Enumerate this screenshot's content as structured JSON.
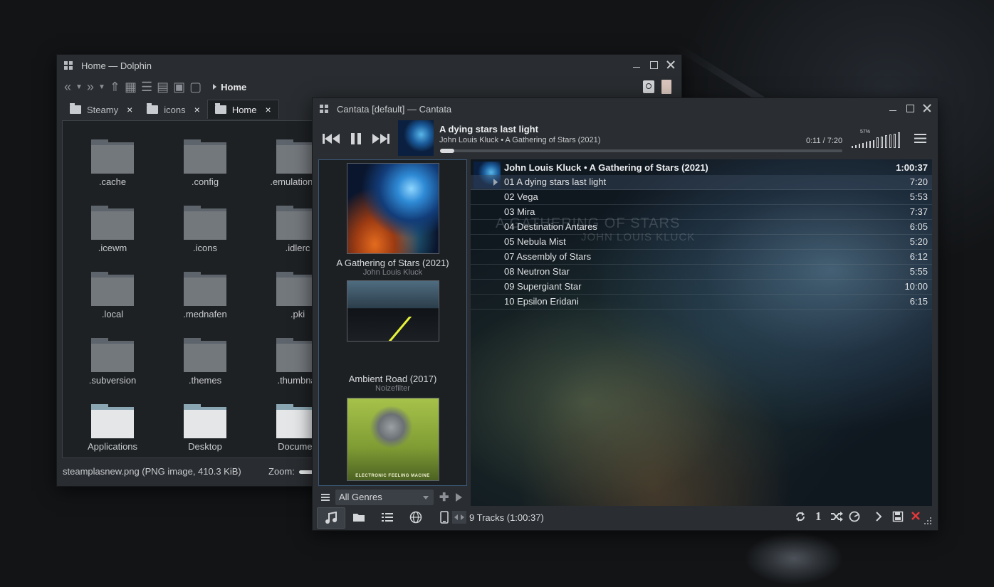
{
  "dolphin": {
    "title": "Home — Dolphin",
    "breadcrumb": "Home",
    "tabs": [
      {
        "label": "Steamy"
      },
      {
        "label": "icons"
      },
      {
        "label": "Home"
      }
    ],
    "tab_close": "×",
    "folders": [
      {
        "name": ".cache"
      },
      {
        "name": ".config"
      },
      {
        "name": ".emulationsta"
      },
      {
        "name": ".icewm"
      },
      {
        "name": ".icons"
      },
      {
        "name": ".idlerc"
      },
      {
        "name": ".local"
      },
      {
        "name": ".mednafen"
      },
      {
        "name": ".pki"
      },
      {
        "name": ".subversion"
      },
      {
        "name": ".themes"
      },
      {
        "name": ".thumbnai"
      },
      {
        "name": "Applications"
      },
      {
        "name": "Desktop"
      },
      {
        "name": "Documen"
      }
    ],
    "status": "steamplasnew.png (PNG image, 410.3 KiB)",
    "zoom_label": "Zoom:"
  },
  "cantata": {
    "title": "Cantata [default] — Cantata",
    "now_playing": {
      "title": "A dying stars last light",
      "artist_album": "John Louis Kluck • A Gathering of Stars (2021)",
      "time": "0:11 / 7:20",
      "progress": 0.025,
      "volume_label": "57%",
      "volume": 0.57
    },
    "library": {
      "albums": [
        {
          "name": "A Gathering of Stars (2021)",
          "artist": "John Louis Kluck"
        },
        {
          "name": "Ambient Road (2017)",
          "artist": "Noizefilter"
        },
        {
          "name": "",
          "artist": "",
          "cover_text": "ELECTRONIC FEELING MACINE"
        }
      ],
      "genre": "All Genres"
    },
    "playlist": {
      "album_header": "John Louis Kluck • A Gathering of Stars (2021)",
      "total": "1:00:37",
      "watermark_title": "A GATHERING OF STARS",
      "watermark_artist": "JOHN LOUIS KLUCK",
      "tracks": [
        {
          "title": "01 A dying stars last light",
          "duration": "7:20"
        },
        {
          "title": "02 Vega",
          "duration": "5:53"
        },
        {
          "title": "03 Mira",
          "duration": "7:37"
        },
        {
          "title": "04 Destination Antares",
          "duration": "6:05"
        },
        {
          "title": "05 Nebula Mist",
          "duration": "5:20"
        },
        {
          "title": "07 Assembly of Stars",
          "duration": "6:12"
        },
        {
          "title": "08 Neutron Star",
          "duration": "5:55"
        },
        {
          "title": "09 Supergiant Star",
          "duration": "10:00"
        },
        {
          "title": "10 Epsilon Eridani",
          "duration": "6:15"
        }
      ]
    },
    "status": "9 Tracks (1:00:37)",
    "nav_icons": [
      "music-note-icon",
      "folder-icon",
      "list-icon",
      "globe-icon",
      "device-icon"
    ],
    "control_icons": [
      "repeat-icon",
      "single-icon",
      "shuffle-icon",
      "consume-icon",
      "forward-icon",
      "save-icon",
      "clear-icon"
    ],
    "single_glyph": "1",
    "accent_color": "#3a5a78",
    "clear_color": "#e0383b"
  }
}
